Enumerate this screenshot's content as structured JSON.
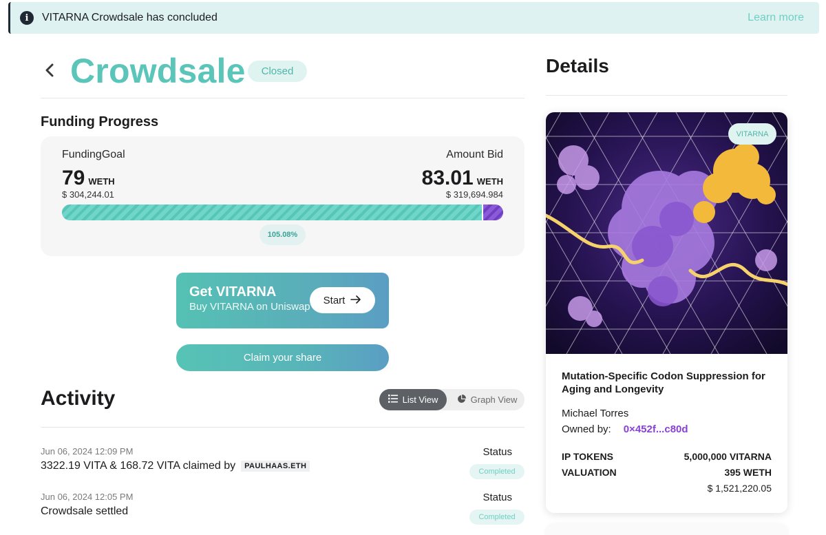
{
  "banner": {
    "message": "VITARNA Crowdsale has concluded",
    "link": "Learn more"
  },
  "header": {
    "title": "Crowdsale",
    "status": "Closed"
  },
  "funding": {
    "section_title": "Funding Progress",
    "goal_label": "FundingGoal",
    "goal_value": "79",
    "goal_unit": "WETH",
    "goal_usd": "$ 304,244.01",
    "bid_label": "Amount Bid",
    "bid_value": "83.01",
    "bid_unit": "WETH",
    "bid_usd": "$ 319,694.984",
    "percent": "105.08%",
    "progress_ratio": 1.0508
  },
  "get_card": {
    "title": "Get VITARNA",
    "subtitle": "Buy VITARNA on Uniswap",
    "start_label": "Start",
    "start_icon": "arrow-right-icon"
  },
  "claim": {
    "label": "Claim your share"
  },
  "activity": {
    "title": "Activity",
    "list_view": "List View",
    "graph_view": "Graph View",
    "rows": [
      {
        "date": "Jun 06, 2024 12:09 PM",
        "text": "3322.19 VITA & 168.72 VITA claimed by",
        "address": "PAULHAAS.ETH",
        "status_label": "Status",
        "status": "Completed"
      },
      {
        "date": "Jun 06, 2024 12:05 PM",
        "text": "Crowdsale settled",
        "address": "",
        "status_label": "Status",
        "status": "Completed"
      }
    ]
  },
  "details": {
    "title": "Details",
    "token_badge": "VITARNA",
    "project_title": "Mutation-Specific Codon Suppression for Aging and Longevity",
    "author": "Michael Torres",
    "owned_label": "Owned by:",
    "owner": "0×452f...c80d",
    "ip_tokens_label": "IP TOKENS",
    "ip_tokens_value": "5,000,000 VITARNA",
    "valuation_label": "VALUATION",
    "valuation_value": "395 WETH",
    "valuation_usd": "$ 1,521,220.05"
  },
  "colors": {
    "accent": "#5cc5ba",
    "owner": "#8a3fd6",
    "over_funding": "#7a48cc"
  }
}
